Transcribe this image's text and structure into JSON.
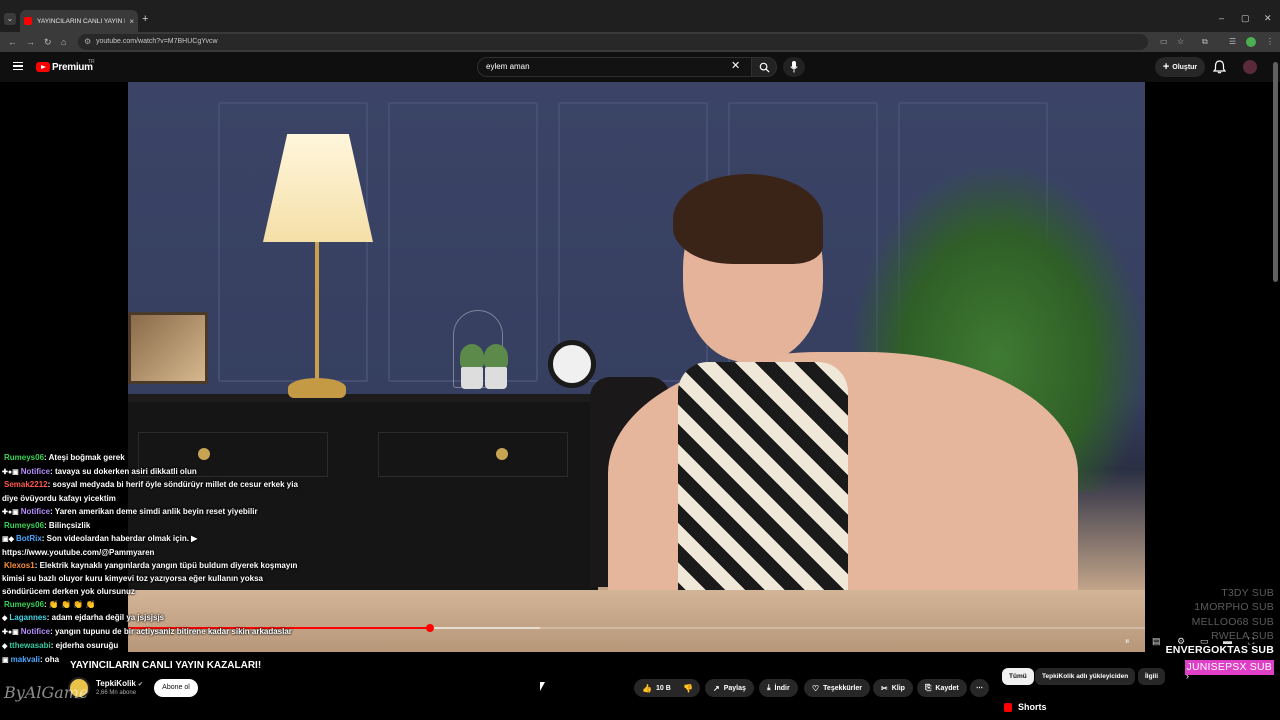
{
  "browser": {
    "tab_title": "YAYINCILARIN CANLI YAYIN KA",
    "tab_close": "×",
    "new_tab": "+",
    "url": "youtube.com/watch?v=M7BHUCgYvcw",
    "window_controls": [
      "–",
      "▢",
      "✕"
    ]
  },
  "masthead": {
    "brand": "Premium",
    "country": "TR",
    "search_query": "eylem aman",
    "create_label": "Oluştur"
  },
  "chat": [
    {
      "user": "Rumeys06",
      "color": "green",
      "badges": "",
      "message": ": Ateşi boğmak gerek"
    },
    {
      "user": "Notifice",
      "color": "purple",
      "badges": "✚●▣",
      "message": ": tavaya su dokerken asiri dikkatli olun"
    },
    {
      "user": "Semak2212",
      "color": "red",
      "badges": "",
      "message": ": sosyal medyada bi herif öyle söndürüyr millet de cesur erkek yia diye övüyordu kafayı yicektim"
    },
    {
      "user": "Notifice",
      "color": "purple",
      "badges": "✚●▣",
      "message": ": Yaren amerikan deme simdi anlik beyin reset yiyebilir"
    },
    {
      "user": "Rumeys06",
      "color": "green",
      "badges": "",
      "message": ": Bilinçsizlik"
    },
    {
      "user": "BotRix",
      "color": "blue",
      "badges": "▣◆",
      "message": ": Son videolardan haberdar olmak için. ▶ https://www.youtube.com/@Pammyaren"
    },
    {
      "user": "Klexos1",
      "color": "orange",
      "badges": "",
      "message": ": Elektrik kaynaklı yangınlarda yangın tüpü buldum diyerek koşmayın kimisi su bazlı oluyor kuru kimyevi toz yazıyorsa eğer kullanın yoksa söndürücem derken yok olursunuz"
    },
    {
      "user": "Rumeys06",
      "color": "green",
      "badges": "",
      "message": ": 👏 👏 👏 👏"
    },
    {
      "user": "Lagannes",
      "color": "cyan",
      "badges": "◆",
      "message": ": adam ejdarha değil ya jsjsjsjs"
    },
    {
      "user": "Notifice",
      "color": "purple",
      "badges": "✚●▣",
      "message": ": yangın tupunu de bir actiysaniz bitirene kadar sikin arkadaslar"
    },
    {
      "user": "tthewasabi",
      "color": "teal",
      "badges": "◆",
      "message": ": ejderha osuruğu"
    },
    {
      "user": "makvali",
      "color": "blue",
      "badges": "▣",
      "message": ": oha"
    }
  ],
  "sub_alerts": [
    "T3DY SUB",
    "1MORPHO SUB",
    "MELLOO68 SUB",
    "RWELA SUB",
    "ENVERGOKTAS SUB",
    "JUNISEPSX SUB"
  ],
  "video": {
    "title": "YAYINCILARIN CANLI YAYIN KAZALARI!",
    "progress_fraction": 0.297,
    "buffer_fraction": 0.405
  },
  "channel": {
    "name": "TepkiKolik",
    "verified": "✔",
    "subscribers": "2,66 Mn abone",
    "subscribe_label": "Abone ol"
  },
  "actions": {
    "like_count": "10 B",
    "share": "Paylaş",
    "download": "İndir",
    "thanks": "Teşekkürler",
    "clip": "Klip",
    "save": "Kaydet",
    "more": "⋯"
  },
  "chips": [
    "Tümü",
    "TepkiKolik adlı yükleyiciden",
    "İlgili"
  ],
  "shorts_label": "Shorts",
  "watermark": "ByAlGame"
}
